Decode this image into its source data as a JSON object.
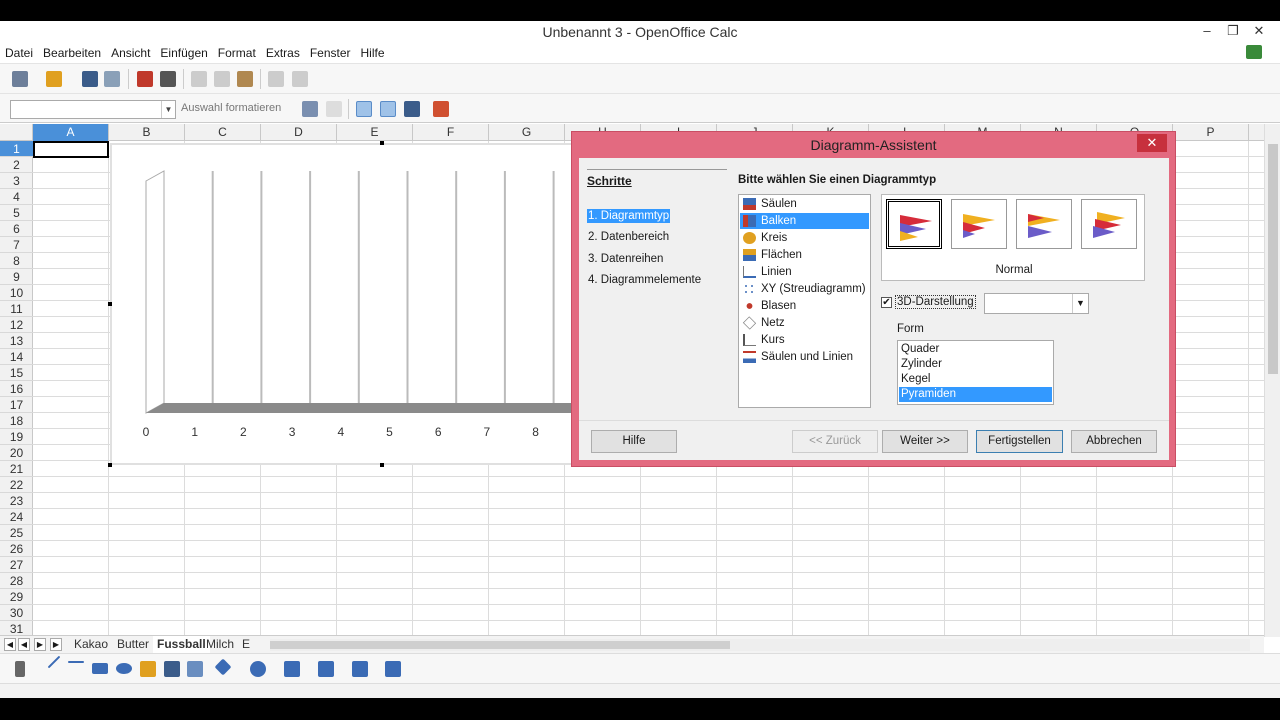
{
  "window": {
    "title": "Unbenannt 3 - OpenOffice Calc",
    "controls": [
      "–",
      "❐",
      "✕"
    ]
  },
  "menu": [
    "Datei",
    "Bearbeiten",
    "Ansicht",
    "Einfügen",
    "Format",
    "Extras",
    "Fenster",
    "Hilfe"
  ],
  "format_toolbar": {
    "selection_placeholder": "Auswahl formatieren"
  },
  "columns": [
    "A",
    "B",
    "C",
    "D",
    "E",
    "F",
    "G",
    "H",
    "I",
    "J",
    "K",
    "L",
    "M",
    "N",
    "O",
    "P"
  ],
  "rows": [
    "1",
    "2",
    "3",
    "4",
    "5",
    "6",
    "7",
    "8",
    "9",
    "10",
    "11",
    "12",
    "13",
    "14",
    "15",
    "16",
    "17",
    "18",
    "19",
    "20",
    "21",
    "22",
    "23",
    "24",
    "25",
    "26",
    "27",
    "28",
    "29",
    "30",
    "31"
  ],
  "chart_data": {
    "type": "bar",
    "categories": [
      "0",
      "1",
      "2",
      "3",
      "4",
      "5",
      "6",
      "7",
      "8"
    ],
    "values": [],
    "title": "",
    "xlabel": "",
    "ylabel": "",
    "grid": true,
    "note_3d": true
  },
  "sheet_tabs": {
    "tabs": [
      "Kakao",
      "Butter",
      "Fussball",
      "Milch",
      "E"
    ],
    "active": "Fussball"
  },
  "dialog": {
    "title": "Diagramm-Assistent",
    "close": "✕",
    "steps_title": "Schritte",
    "steps": [
      "1. Diagrammtyp",
      "2. Datenbereich",
      "3. Datenreihen",
      "4. Diagrammelemente"
    ],
    "prompt": "Bitte wählen Sie einen Diagrammtyp",
    "chart_types": [
      "Säulen",
      "Balken",
      "Kreis",
      "Flächen",
      "Linien",
      "XY (Streudiagramm)",
      "Blasen",
      "Netz",
      "Kurs",
      "Säulen und Linien"
    ],
    "selected_type": "Balken",
    "variant_label": "Normal",
    "checkbox_3d": "3D-Darstellung",
    "form_label": "Form",
    "forms": [
      "Quader",
      "Zylinder",
      "Kegel",
      "Pyramiden"
    ],
    "selected_form": "Pyramiden",
    "buttons": {
      "help": "Hilfe",
      "back": "<< Zurück",
      "next": "Weiter >>",
      "finish": "Fertigstellen",
      "cancel": "Abbrechen"
    }
  }
}
